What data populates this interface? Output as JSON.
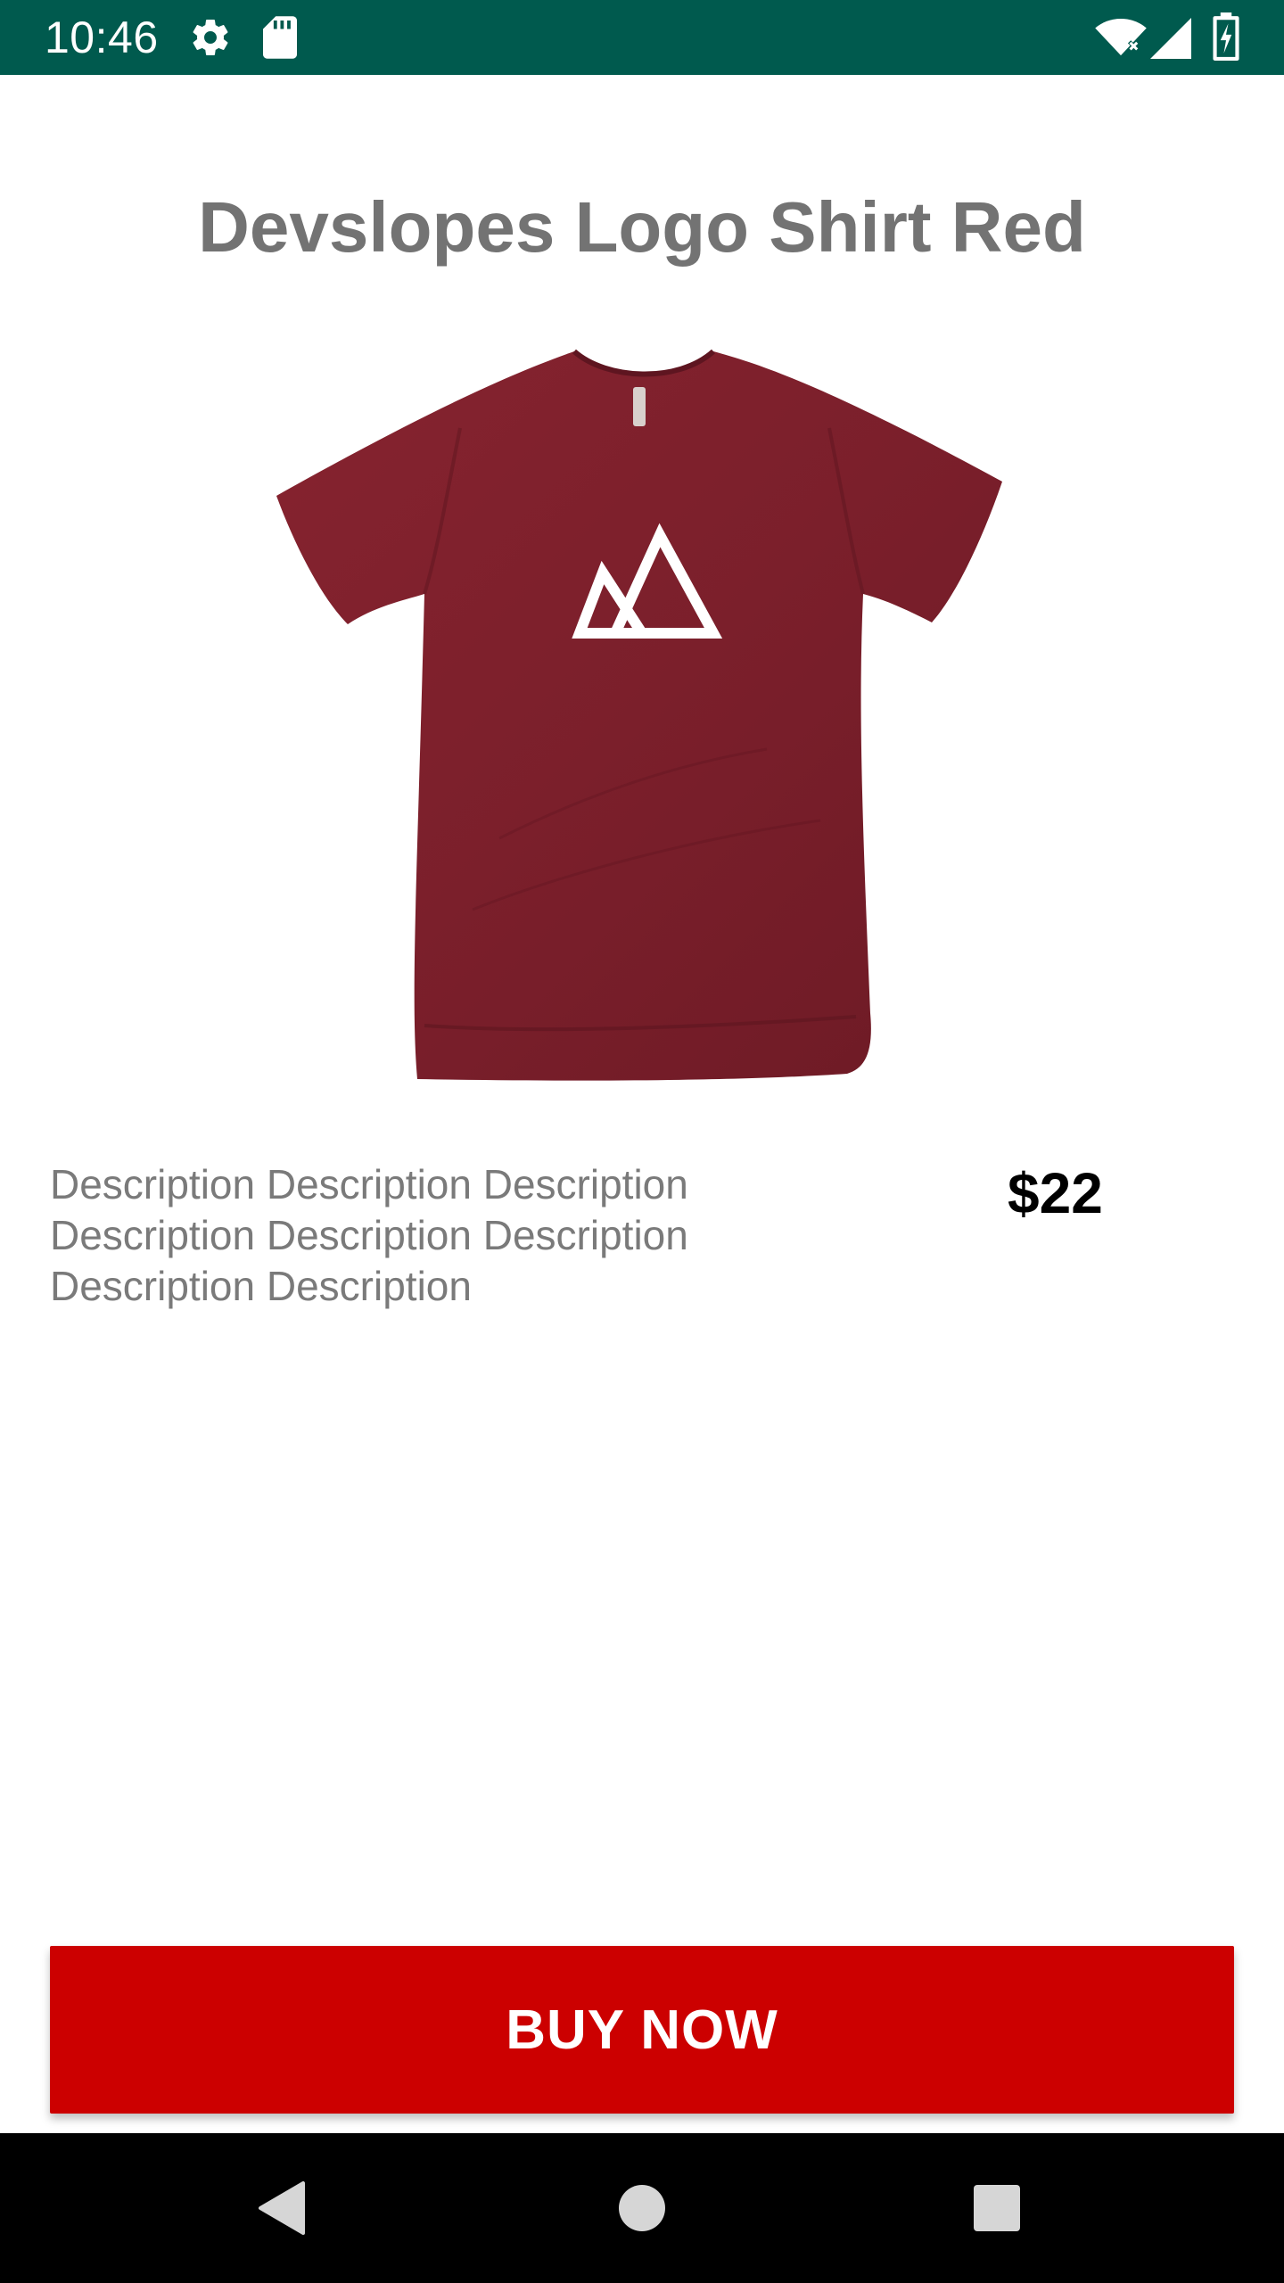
{
  "status_bar": {
    "time": "10:46",
    "background_color": "#005a4e",
    "icons": [
      "gear-icon",
      "sd-card-icon",
      "wifi-icon",
      "cell-signal-icon",
      "battery-charging-icon"
    ]
  },
  "product": {
    "title": "Devslopes Logo Shirt Red",
    "image": "red-shirt-with-mountain-logo",
    "shirt_color": "#7e2230",
    "description": "Description Description Description Description Description Description Description Description",
    "price": "$22"
  },
  "actions": {
    "buy_now_label": "BUY NOW",
    "buy_button_color": "#cc0000"
  },
  "nav_bar": {
    "icons": [
      "back-icon",
      "home-icon",
      "recents-icon"
    ]
  }
}
